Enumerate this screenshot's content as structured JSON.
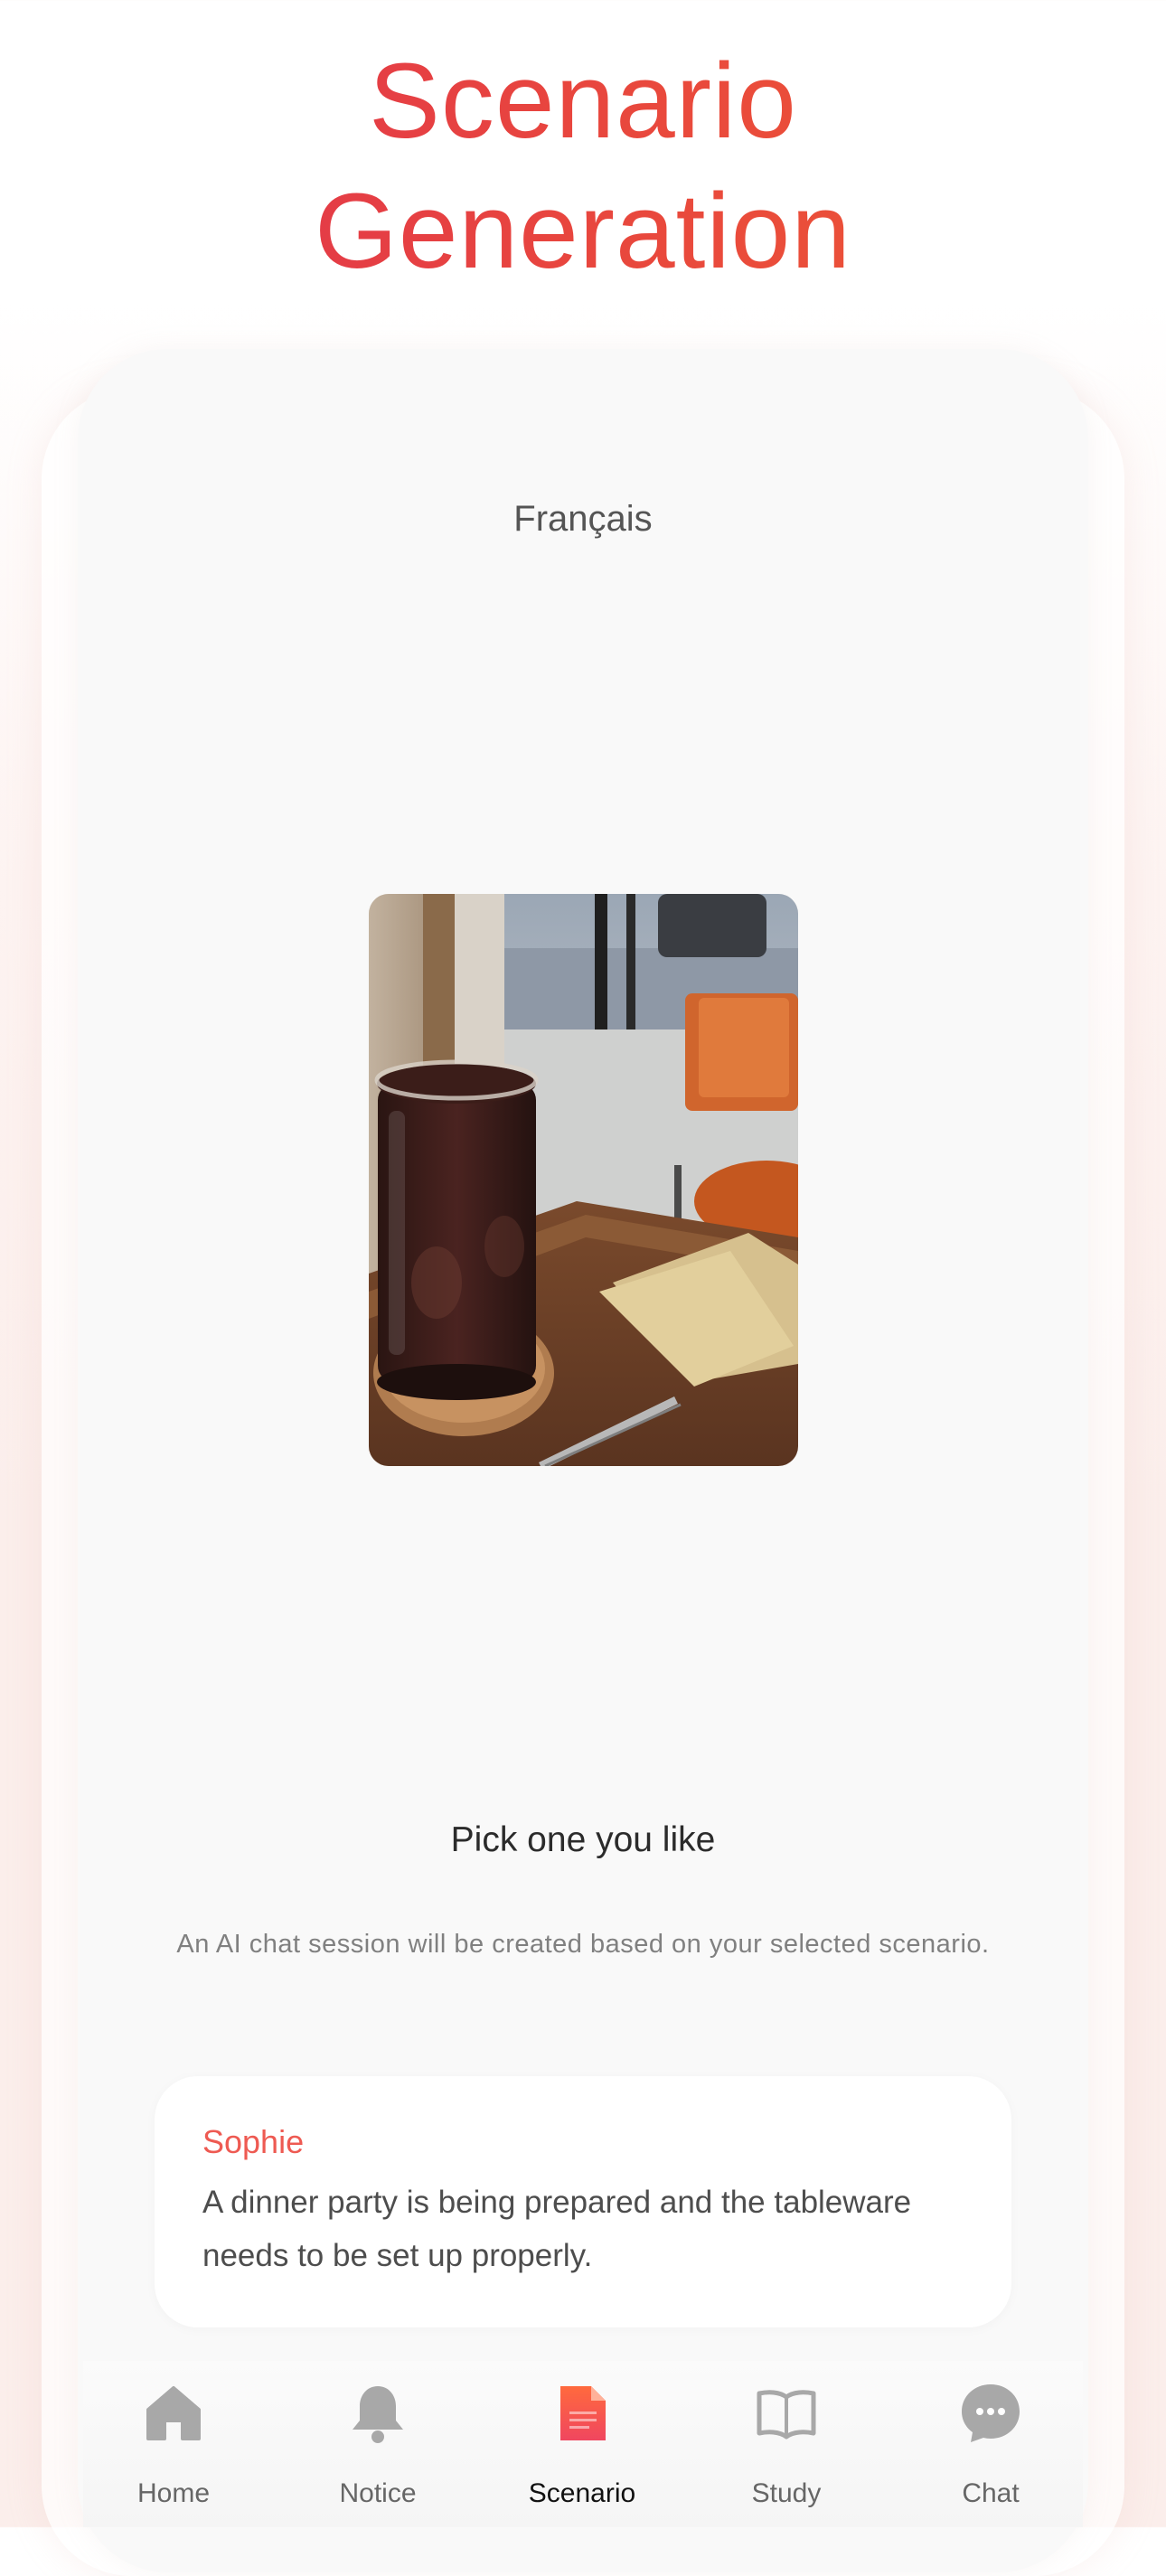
{
  "header": {
    "title_line1": "Scenario",
    "title_line2": "Generation"
  },
  "language": {
    "label": "Français"
  },
  "photo": {
    "subject": "iced-coffee-on-cafe-table"
  },
  "picker": {
    "title": "Pick one you like",
    "subtitle": "An AI chat session will be created based on your selected scenario."
  },
  "scenario": {
    "name": "Sophie",
    "text": "A dinner party is being prepared and the tableware needs to be set up properly."
  },
  "tabbar": {
    "items": [
      {
        "label": "Home",
        "icon": "home-icon"
      },
      {
        "label": "Notice",
        "icon": "bell-icon"
      },
      {
        "label": "Scenario",
        "icon": "document-icon"
      },
      {
        "label": "Study",
        "icon": "book-icon"
      },
      {
        "label": "Chat",
        "icon": "chat-bubble-icon"
      }
    ],
    "active": "Scenario"
  },
  "colors": {
    "accent": "#e8463e",
    "scenario_name": "#ee5a52",
    "inactive_icon": "#a8a8a8"
  }
}
